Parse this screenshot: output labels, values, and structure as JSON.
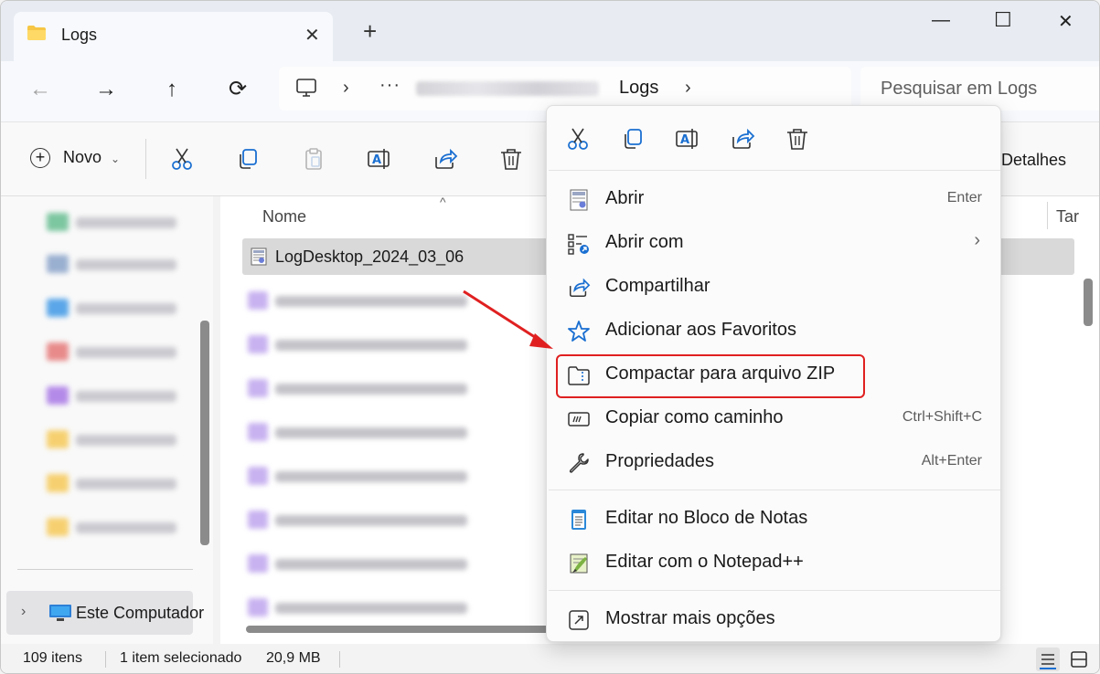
{
  "window": {
    "tab_title": "Logs",
    "tab_close": "✕",
    "new_tab": "+",
    "minimize": "—",
    "maximize": "☐",
    "close": "✕"
  },
  "nav": {
    "back": "←",
    "forward": "→",
    "up": "↑",
    "refresh": "⟳",
    "ellipsis": "···",
    "current_folder": "Logs",
    "chevron": "›",
    "search_placeholder": "Pesquisar em Logs"
  },
  "toolbar": {
    "new_label": "Novo",
    "new_caret": "⌄",
    "details_label": "Detalhes"
  },
  "sidebar": {
    "computer_label": "Este Computador",
    "expand": "›"
  },
  "file_list": {
    "col_name": "Nome",
    "col_size": "Tar",
    "sort_caret": "^",
    "selected_file": "LogDesktop_2024_03_06"
  },
  "status": {
    "item_count": "109 itens",
    "selection": "1 item selecionado",
    "size": "20,9 MB"
  },
  "context_menu": {
    "items": [
      {
        "label": "Abrir",
        "shortcut": "Enter"
      },
      {
        "label": "Abrir com",
        "submenu": "›"
      },
      {
        "label": "Compartilhar"
      },
      {
        "label": "Adicionar aos Favoritos"
      },
      {
        "label": "Compactar para arquivo ZIP"
      },
      {
        "label": "Copiar como caminho",
        "shortcut": "Ctrl+Shift+C"
      },
      {
        "label": "Propriedades",
        "shortcut": "Alt+Enter"
      },
      {
        "label": "Editar no Bloco de Notas"
      },
      {
        "label": "Editar com o Notepad++"
      },
      {
        "label": "Mostrar mais opções"
      }
    ]
  },
  "colors": {
    "annotation_red": "#e02020",
    "accent_blue": "#1a6fd1",
    "folder_yellow": "#f6c644"
  }
}
